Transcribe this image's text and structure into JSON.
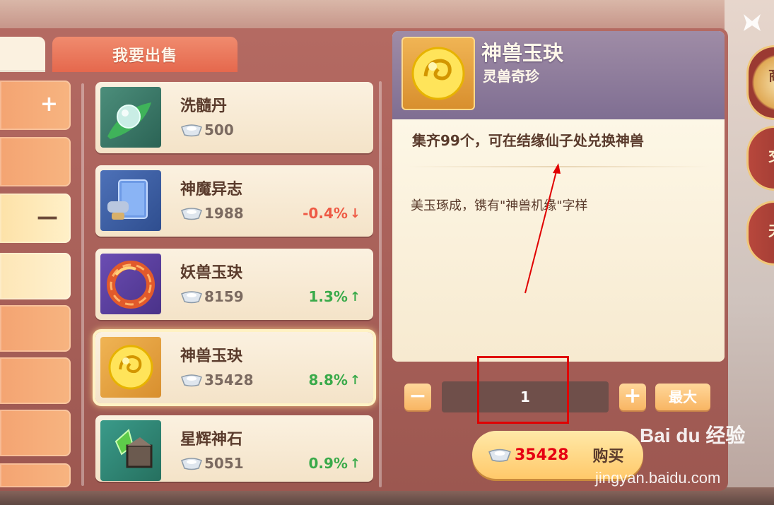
{
  "market": {
    "tab_sell_label": "我要出售",
    "categories": [
      {
        "sign": "+"
      },
      {
        "sign": ""
      },
      {
        "sign": "—"
      },
      {
        "sign": ""
      },
      {
        "sign": ""
      },
      {
        "sign": ""
      },
      {
        "sign": ""
      }
    ],
    "items": [
      {
        "name": "洗髓丹",
        "price": "500",
        "change": "",
        "direction": "none",
        "icon": "jade-pill-on-leaf-icon"
      },
      {
        "name": "神魔异志",
        "price": "1988",
        "change": "-0.4%",
        "direction": "down",
        "icon": "scroll-book-icon"
      },
      {
        "name": "妖兽玉玦",
        "price": "8159",
        "change": "1.3%",
        "direction": "up",
        "icon": "red-dragon-jade-icon"
      },
      {
        "name": "神兽玉玦",
        "price": "35428",
        "change": "8.8%",
        "direction": "up",
        "icon": "golden-jade-icon",
        "selected": true
      },
      {
        "name": "星辉神石",
        "price": "5051",
        "change": "0.9%",
        "direction": "up",
        "icon": "star-gem-stone-icon"
      }
    ]
  },
  "detail": {
    "title": "神兽玉玦",
    "subtitle": "灵兽奇珍",
    "line1": "集齐99个，可在结缘仙子处兑换神兽",
    "line2": "美玉琢成，镌有\"神兽机缘\"字样",
    "quantity": "1",
    "minus": "−",
    "plus": "+",
    "max_label": "最大",
    "buy_price": "35428",
    "buy_label": "购买"
  },
  "side_tabs": [
    "商",
    "交",
    "天"
  ],
  "watermark": {
    "main": "Bai du 经验",
    "sub": "jingyan.baidu.com"
  },
  "colors": {
    "price_red": "#e60012",
    "up_green": "#3aaa4a",
    "down_red": "#ee5a45",
    "annotation": "#e00000"
  }
}
